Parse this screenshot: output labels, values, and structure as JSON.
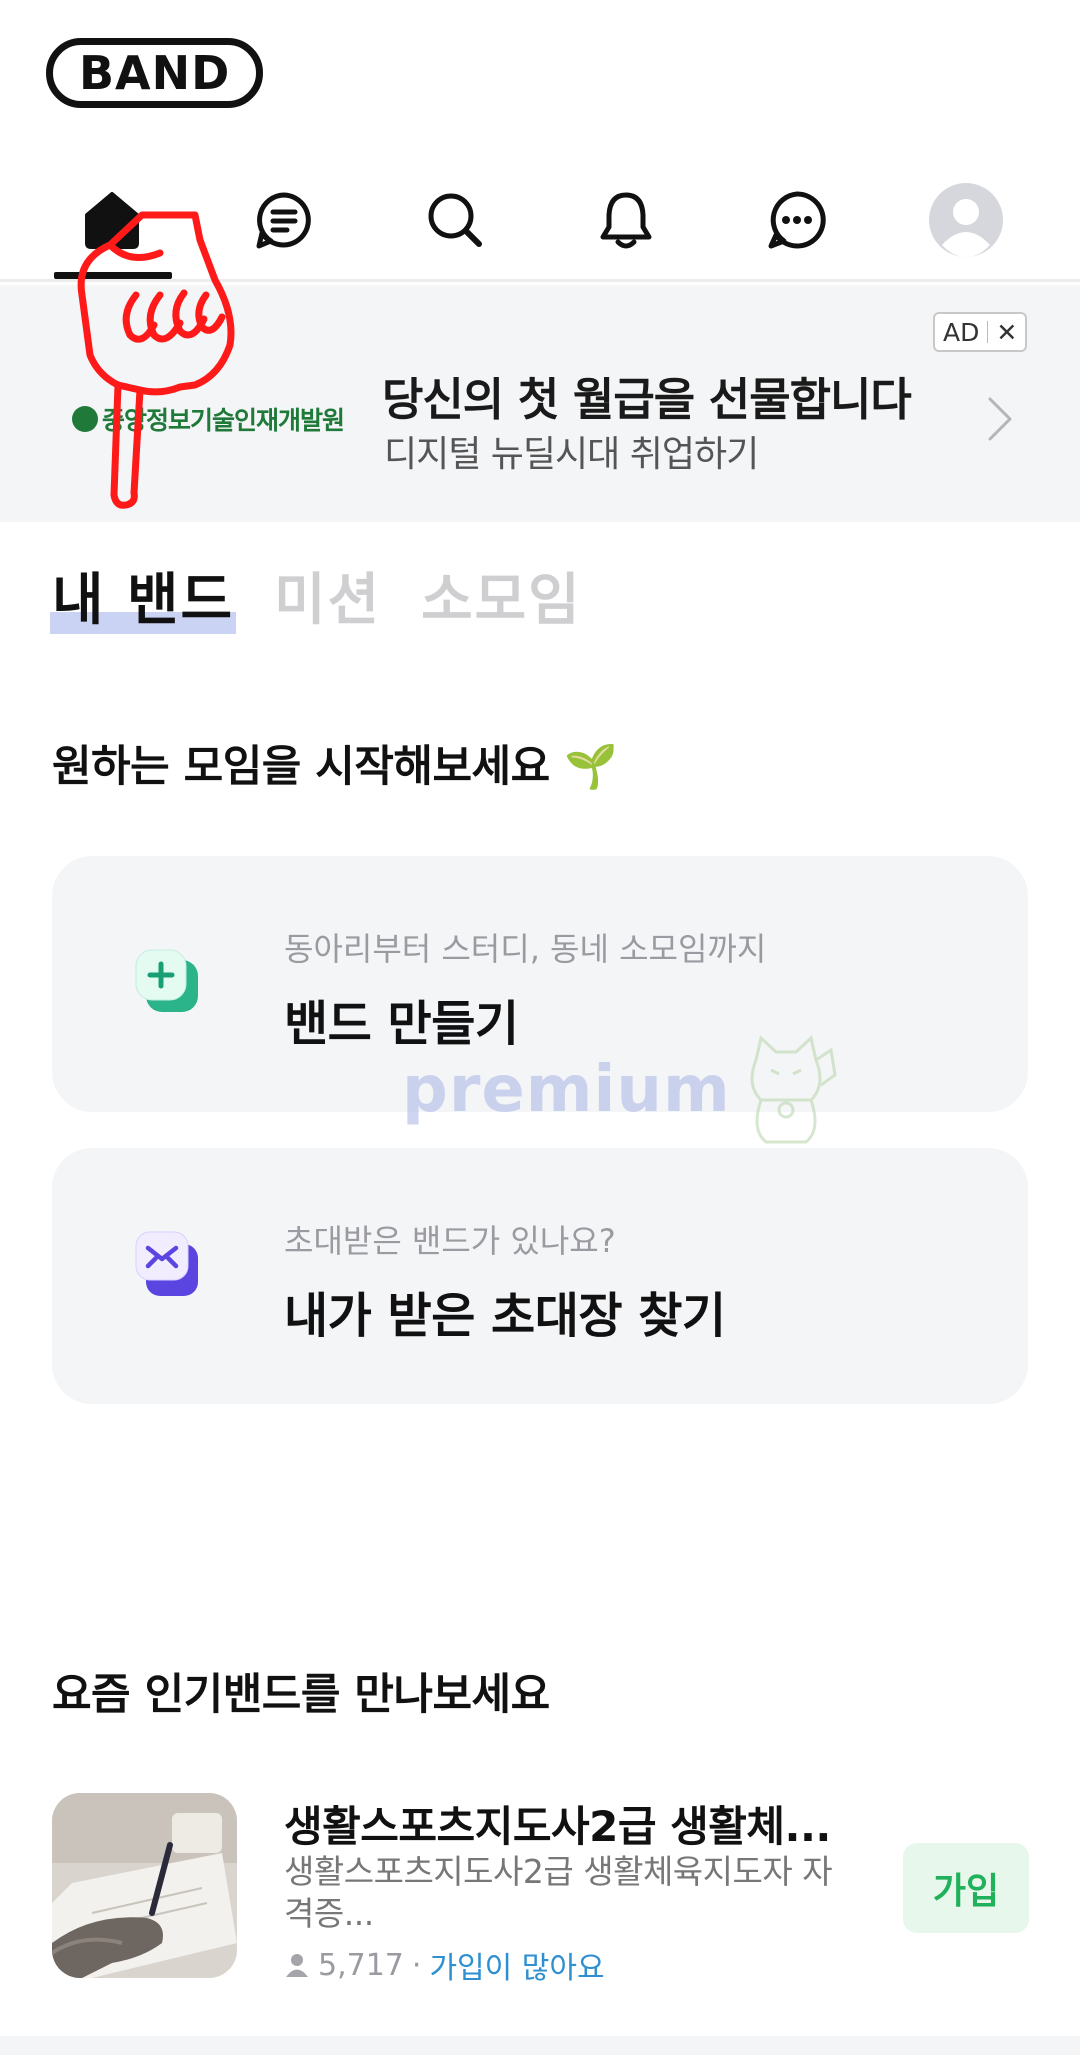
{
  "app": {
    "logo_text": "BAND"
  },
  "topnav": {
    "items": [
      {
        "name": "home",
        "icon": "home-icon",
        "active": true
      },
      {
        "name": "feed",
        "icon": "feed-icon",
        "active": false
      },
      {
        "name": "search",
        "icon": "search-icon",
        "active": false
      },
      {
        "name": "notifications",
        "icon": "bell-icon",
        "active": false
      },
      {
        "name": "chat",
        "icon": "chat-icon",
        "active": false
      },
      {
        "name": "profile",
        "icon": "avatar-icon",
        "active": false
      }
    ]
  },
  "ad": {
    "advertiser": "중앙정보기술인재개발원",
    "title": "당신의 첫 월급을 선물합니다",
    "subtitle": "디지털 뉴딜시대 취업하기",
    "badge_label": "AD",
    "close_symbol": "✕"
  },
  "segment_tabs": [
    {
      "label": "내 밴드",
      "active": true
    },
    {
      "label": "미션",
      "active": false
    },
    {
      "label": "소모임",
      "active": false
    }
  ],
  "start_section": {
    "heading": "원하는 모임을 시작해보세요 🌱",
    "cards": [
      {
        "subtitle": "동아리부터 스터디, 동네 소모임까지",
        "title": "밴드 만들기",
        "icon": "plus-icon"
      },
      {
        "subtitle": "초대받은 밴드가 있나요?",
        "title": "내가 받은 초대장 찾기",
        "icon": "envelope-icon"
      }
    ]
  },
  "watermark": {
    "text": "premium"
  },
  "popular_section": {
    "heading": "요즘 인기밴드를 만나보세요",
    "bands": [
      {
        "name": "생활스포츠지도사2급 생활체...",
        "description": "생활스포츠지도사2급 생활체육지도자 자격증...",
        "members": "5,717",
        "separator": "·",
        "status": "가입이 많아요",
        "join_label": "가입"
      }
    ]
  },
  "colors": {
    "accent_green": "#20b15a",
    "join_bg": "#e7f7ec",
    "card_bg": "#f4f5f7",
    "hot_text": "#2f8fd0",
    "annotation_red": "#ff1a1a"
  }
}
